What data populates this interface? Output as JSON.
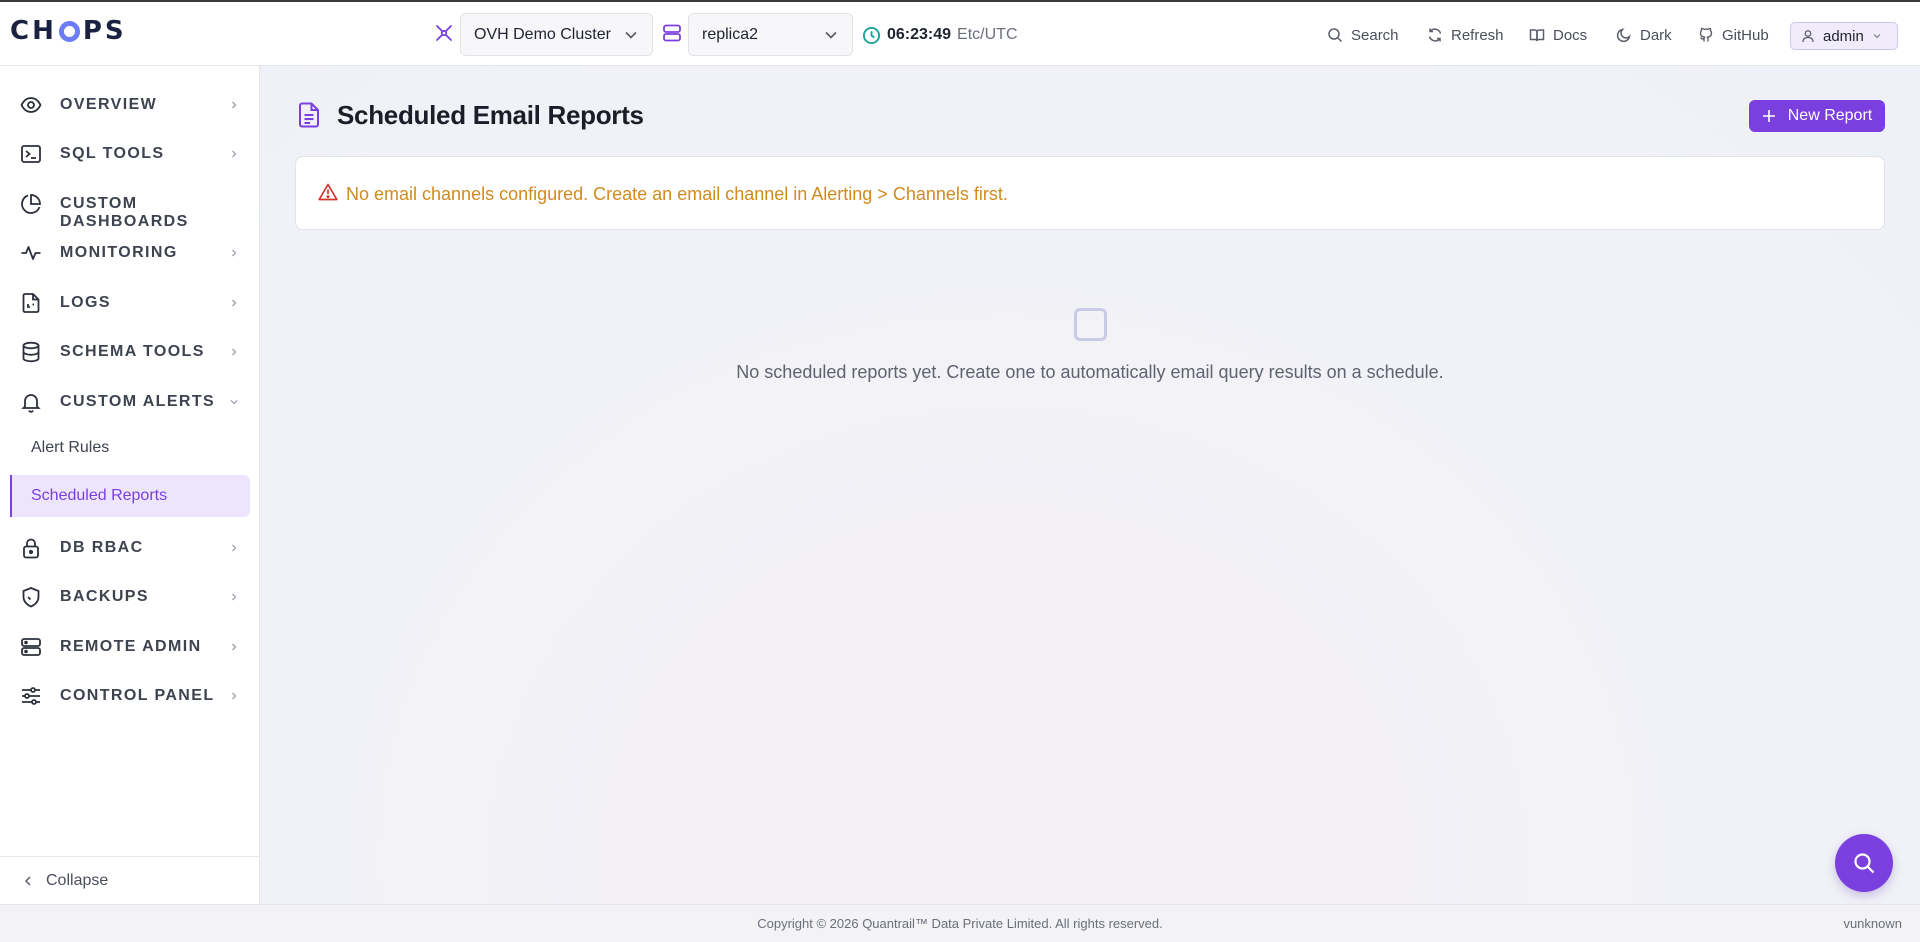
{
  "app": {
    "logo_text_left": "CH",
    "logo_text_right": "PS"
  },
  "topbar": {
    "cluster_value": "OVH Demo Cluster",
    "replica_value": "replica2",
    "clock_time": "06:23:49",
    "clock_timezone": "Etc/UTC",
    "search_label": "Search",
    "refresh_label": "Refresh",
    "docs_label": "Docs",
    "theme_label": "Dark",
    "github_label": "GitHub",
    "user_label": "admin"
  },
  "sidebar": {
    "items": [
      {
        "label": "OVERVIEW",
        "icon": "eye-icon"
      },
      {
        "label": "SQL TOOLS",
        "icon": "terminal-icon"
      },
      {
        "label": "CUSTOM DASHBOARDS",
        "icon": "pie-chart-icon"
      },
      {
        "label": "MONITORING",
        "icon": "activity-icon"
      },
      {
        "label": "LOGS",
        "icon": "file-log-icon"
      },
      {
        "label": "SCHEMA TOOLS",
        "icon": "database-icon"
      },
      {
        "label": "CUSTOM ALERTS",
        "icon": "bell-icon"
      },
      {
        "label": "DB RBAC",
        "icon": "lock-icon"
      },
      {
        "label": "BACKUPS",
        "icon": "shield-icon"
      },
      {
        "label": "REMOTE ADMIN",
        "icon": "server-icon"
      },
      {
        "label": "CONTROL PANEL",
        "icon": "sliders-icon"
      }
    ],
    "sub_items": [
      {
        "label": "Alert Rules",
        "active": false
      },
      {
        "label": "Scheduled Reports",
        "active": true
      }
    ],
    "collapse_label": "Collapse"
  },
  "main": {
    "title": "Scheduled Email Reports",
    "new_report_label": "New Report",
    "alert_message": "No email channels configured. Create an email channel in Alerting > Channels first.",
    "empty_message": "No scheduled reports yet. Create one to automatically email query results on a schedule."
  },
  "footer": {
    "copyright": "Copyright © 2026 Quantrail™ Data Private Limited. All rights reserved.",
    "version": "vunknown"
  },
  "colors": {
    "accent": "#7b3fe0",
    "warning": "#d08a1e",
    "alert_icon": "#d9322b",
    "clock_icon": "#1aa39a"
  }
}
